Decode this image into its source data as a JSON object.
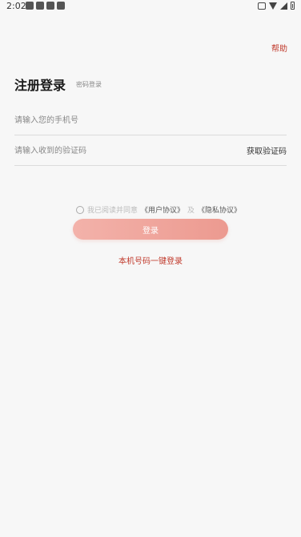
{
  "status_bar": {
    "time": "2:02"
  },
  "header": {
    "help_label": "帮助"
  },
  "main": {
    "title": "注册登录",
    "password_login_label": "密码登录",
    "phone_field": {
      "value": "",
      "placeholder": "请输入您的手机号"
    },
    "code_field": {
      "value": "",
      "placeholder": "请输入收到的验证码"
    },
    "get_code_label": "获取验证码",
    "agreement": {
      "prefix": "我已阅读并同意",
      "user_agreement": "《用户协议》",
      "and": "及",
      "privacy_policy": "《隐私协议》"
    },
    "login_button_label": "登录",
    "one_click_login_label": "本机号码一键登录"
  },
  "colors": {
    "accent": "#c0392b",
    "button_gradient_start": "#f3b2aa",
    "button_gradient_end": "#ec9a90"
  }
}
